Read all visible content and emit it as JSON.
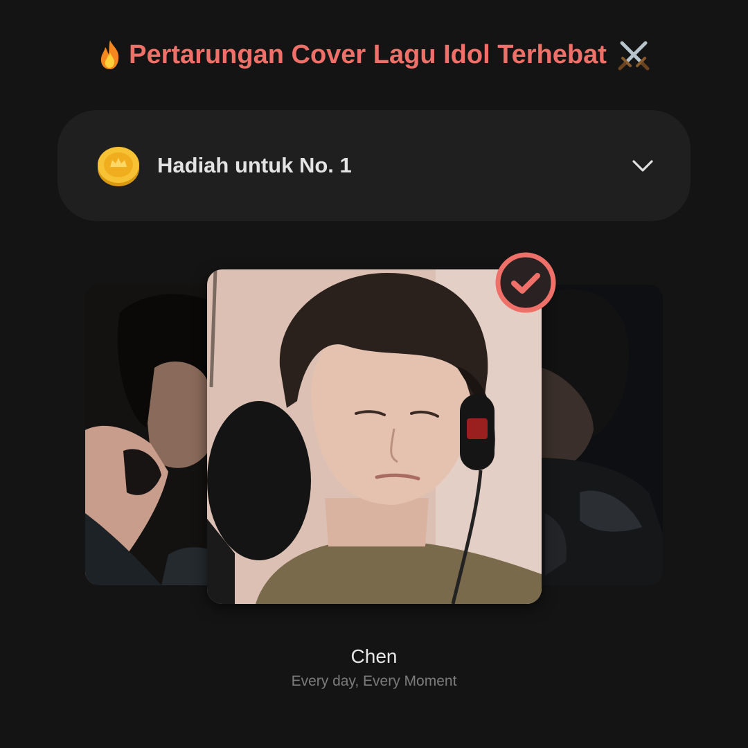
{
  "header": {
    "title": "Pertarungan Cover Lagu Idol Terhebat",
    "leading_icon": "fire-icon",
    "trailing_icon": "crossed-swords-icon",
    "accent_color": "#ef6f69"
  },
  "prize": {
    "label": "Hadiah untuk No. 1",
    "icon": "gold-coin-icon",
    "toggle_icon": "chevron-down-icon"
  },
  "carousel": {
    "selected_index": 1,
    "selected_badge_icon": "check-circle-icon",
    "cards": [
      {
        "icon": "singer-photo-left"
      },
      {
        "icon": "singer-photo-center"
      },
      {
        "icon": "singer-photo-right"
      }
    ]
  },
  "selection": {
    "artist": "Chen",
    "song": "Every day, Every Moment"
  },
  "colors": {
    "background": "#141414",
    "card_background": "#1f1f1f",
    "text_primary": "#e6e6e6",
    "text_secondary": "#7c7c7c"
  }
}
